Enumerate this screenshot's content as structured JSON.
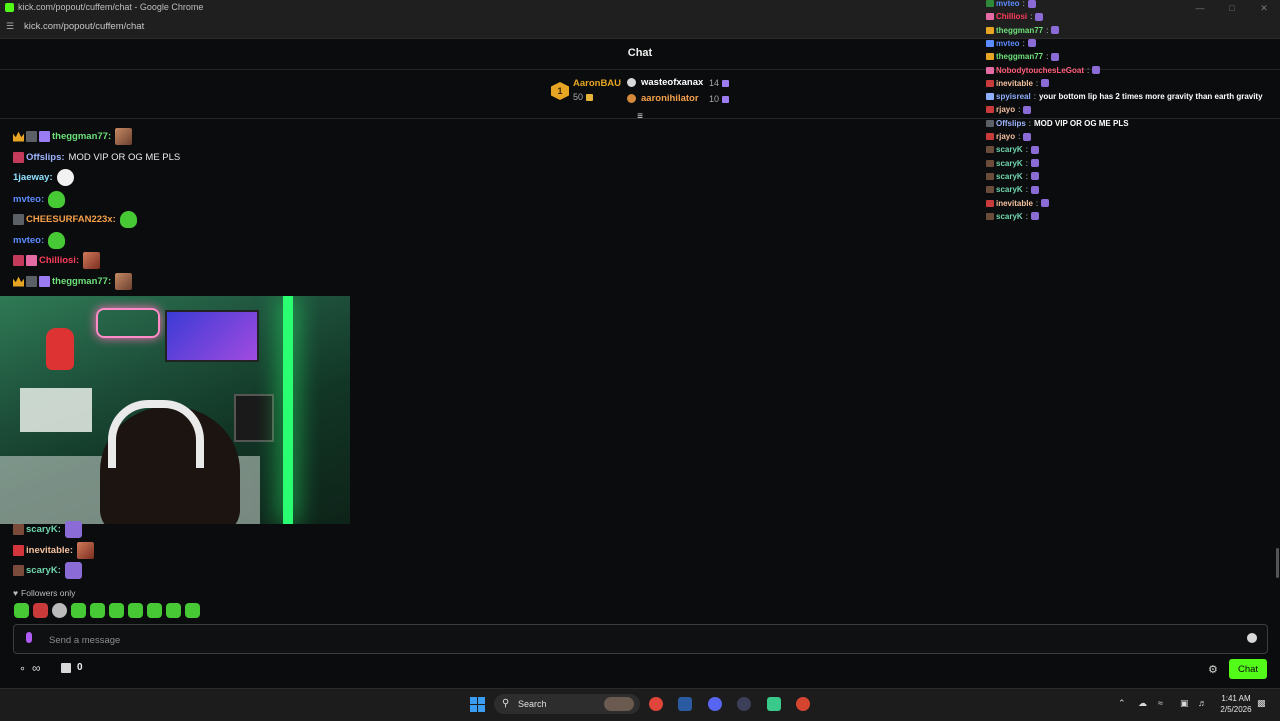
{
  "window": {
    "title": "kick.com/popout/cuffem/chat - Google Chrome",
    "url": "kick.com/popout/cuffem/chat"
  },
  "chat": {
    "header": "Chat",
    "leaderboard": {
      "first": {
        "rank": "1",
        "name": "AaronBAU",
        "count": "50"
      },
      "second": {
        "name": "wasteofxanax",
        "count": "14"
      },
      "third": {
        "name": "aaronihilator",
        "count": "10"
      }
    },
    "messages": [
      {
        "user": "theggman77",
        "color": "#6de07a",
        "text": ""
      },
      {
        "user": "Offslips",
        "color": "#9fb5ff",
        "text": "MOD VIP OR OG ME PLS"
      },
      {
        "user": "1jaeway",
        "color": "#8fe0ff",
        "text": ""
      },
      {
        "user": "mvteo",
        "color": "#5b8cff",
        "text": ""
      },
      {
        "user": "CHEESURFAN223x",
        "color": "#f5a04b",
        "text": ""
      },
      {
        "user": "mvteo",
        "color": "#5b8cff",
        "text": ""
      },
      {
        "user": "Chilliosi",
        "color": "#ff3b5b",
        "text": ""
      },
      {
        "user": "theggman77",
        "color": "#6de07a",
        "text": ""
      },
      {
        "user": "scaryK",
        "color": "#6fd6ae",
        "text": ""
      },
      {
        "user": "inevitable",
        "color": "#f5c2a0",
        "text": ""
      },
      {
        "user": "scaryK",
        "color": "#6fd6ae",
        "text": ""
      }
    ],
    "followers_only": "Followers only",
    "input_placeholder": "Send a message",
    "points": "0",
    "chat_button": "Chat"
  },
  "overlay": [
    {
      "user": "mvteo",
      "color": "#5b8cff",
      "text": ""
    },
    {
      "user": "Chilliosi",
      "color": "#ff3b5b",
      "text": ""
    },
    {
      "user": "theggman77",
      "color": "#6de07a",
      "text": ""
    },
    {
      "user": "mvteo",
      "color": "#5b8cff",
      "text": ""
    },
    {
      "user": "theggman77",
      "color": "#6de07a",
      "text": ""
    },
    {
      "user": "NobodytouchesLeGoat",
      "color": "#ff5c7a",
      "text": ""
    },
    {
      "user": "inevitable",
      "color": "#f5c2a0",
      "text": ""
    },
    {
      "user": "spyisreal",
      "color": "#8fb0ff",
      "text": "your bottom lip has 2 times more gravity than earth gravity"
    },
    {
      "user": "rjayo",
      "color": "#f5c2a0",
      "text": ""
    },
    {
      "user": "Offslips",
      "color": "#9fb5ff",
      "text": "MOD VIP OR OG ME PLS"
    },
    {
      "user": "rjayo",
      "color": "#f5c2a0",
      "text": ""
    },
    {
      "user": "scaryK",
      "color": "#6fd6ae",
      "text": ""
    },
    {
      "user": "scaryK",
      "color": "#6fd6ae",
      "text": ""
    },
    {
      "user": "scaryK",
      "color": "#6fd6ae",
      "text": ""
    },
    {
      "user": "scaryK",
      "color": "#6fd6ae",
      "text": ""
    },
    {
      "user": "inevitable",
      "color": "#f5c2a0",
      "text": ""
    },
    {
      "user": "scaryK",
      "color": "#6fd6ae",
      "text": ""
    }
  ],
  "taskbar": {
    "search_label": "Search",
    "time": "1:41 AM",
    "date": "2/5/2026"
  },
  "colors": {
    "kick_green": "#53fc18",
    "background": "#0b0c0d"
  }
}
